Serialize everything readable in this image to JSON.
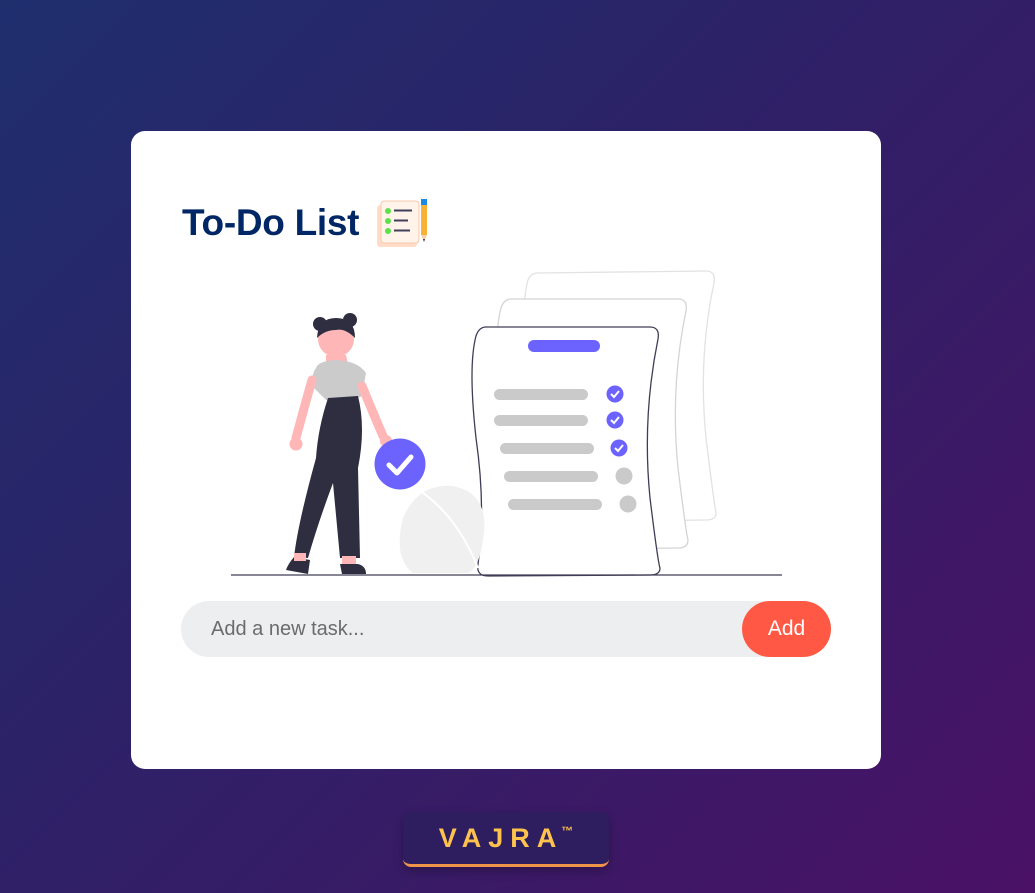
{
  "app": {
    "title": "To-Do List",
    "title_icon": "checklist-pencil-icon"
  },
  "illustration": {
    "name": "woman-with-checklist-illustration"
  },
  "task_form": {
    "input_value": "",
    "input_placeholder": "Add a new task...",
    "add_label": "Add"
  },
  "brand": {
    "name": "VAJRA",
    "trademark": "™"
  },
  "colors": {
    "background_start": "#1f2f6e",
    "background_end": "#4a1166",
    "title": "#002765",
    "accent_purple": "#6c63ff",
    "add_button": "#ff5945",
    "brand_text": "#ffc24d",
    "brand_underline": "#f0944a"
  }
}
